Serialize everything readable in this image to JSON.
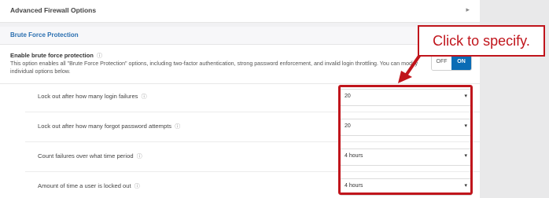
{
  "sections": {
    "advanced_firewall": "Advanced Firewall Options",
    "brute_force": "Brute Force Protection"
  },
  "enable": {
    "title": "Enable brute force protection",
    "description": "This option enables all \"Brute Force Protection\" options, including two-factor authentication, strong password enforcement, and invalid login throttling. You can modify individual options below.",
    "toggle_off": "OFF",
    "toggle_on": "ON",
    "toggle_state": "ON"
  },
  "options": [
    {
      "label": "Lock out after how many login failures",
      "value": "20"
    },
    {
      "label": "Lock out after how many forgot password attempts",
      "value": "20"
    },
    {
      "label": "Count failures over what time period",
      "value": "4 hours"
    },
    {
      "label": "Amount of time a user is locked out",
      "value": "4 hours"
    }
  ],
  "annotation": {
    "callout_text": "Click to specify.",
    "color": "#c0151c"
  },
  "icons": {
    "help": "help-circle-icon",
    "chevron": "chevron-right-icon",
    "caret": "dropdown-caret-icon"
  }
}
